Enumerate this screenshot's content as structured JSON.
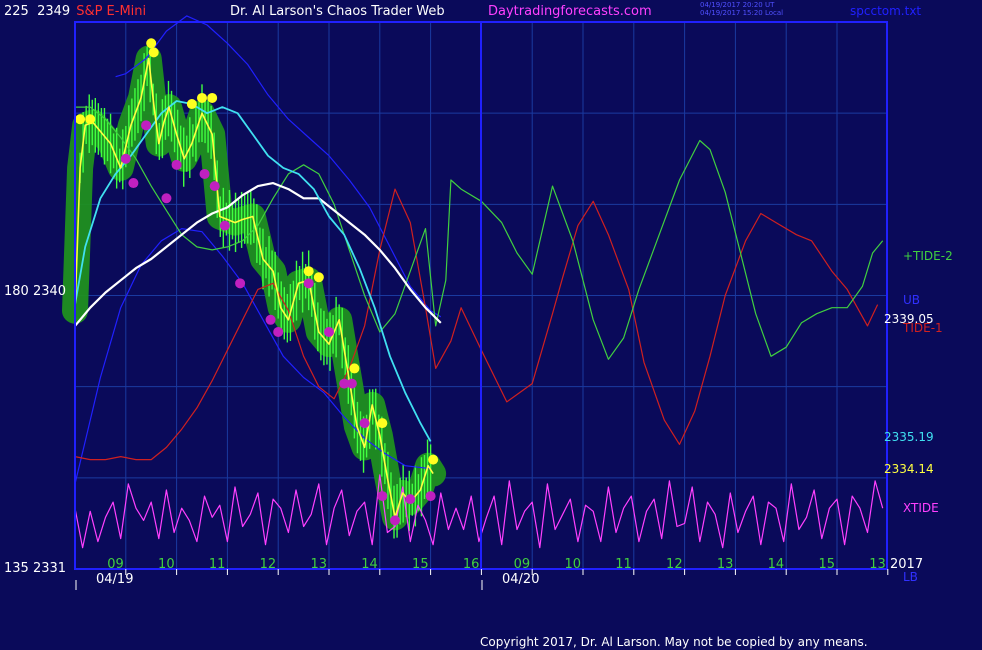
{
  "header": {
    "scale_top": "225",
    "price_top": "2349",
    "symbol": "S&P E-Mini",
    "title": "Dr. Al Larson's Chaos Trader Web",
    "site": "Daytradingforecasts.com",
    "time_utc": "04/19/2017 20:20 UT",
    "time_local": "04/19/2017 15:20 Local",
    "file": "spcctom.txt"
  },
  "footer": {
    "copyright": "Copyright 2017, Dr. Al Larson. May not be copied by any means."
  },
  "colors": {
    "background": "#0a0a5a",
    "frame": "#2020ff",
    "grid": "#1a3aa0",
    "tide1": "#d02020",
    "tide2": "#40d040",
    "xtide": "#ff40ff",
    "band": "#2020ff",
    "ma_white": "#ffffff",
    "ma_cyan": "#40e0f0",
    "price_yellow": "#ffff40",
    "price_bars": "#40ff40",
    "energy_green": "#209020",
    "dot_yellow": "#ffff20",
    "dot_magenta": "#c020c0"
  },
  "chart_data": {
    "type": "line",
    "y_axis_labels": [
      {
        "scale": "225",
        "price": "2349"
      },
      {
        "scale": "180",
        "price": "2340"
      },
      {
        "scale": "135",
        "price": "2331"
      }
    ],
    "ylim": [
      2331,
      2349
    ],
    "x_hour_labels": [
      "09",
      "10",
      "11",
      "12",
      "13",
      "14",
      "15",
      "16",
      "09",
      "10",
      "11",
      "12",
      "13",
      "14",
      "15",
      "13"
    ],
    "x_date_labels": [
      "04/19",
      "04/20"
    ],
    "year_label": "2017",
    "right_labels": [
      {
        "text": "+TIDE-2",
        "color": "#40d040"
      },
      {
        "text": "UB",
        "color": "#3030ff"
      },
      {
        "text": "2339.05",
        "color": "#ffffff"
      },
      {
        "text": "TIDE-1",
        "color": "#d02020"
      },
      {
        "text": "2335.19",
        "color": "#40e0f0"
      },
      {
        "text": "2334.14",
        "color": "#ffff40"
      },
      {
        "text": "XTIDE",
        "color": "#ff40ff"
      },
      {
        "text": "LB",
        "color": "#3030ff"
      }
    ],
    "series": [
      {
        "name": "TIDE-1",
        "x": [
          0,
          0.3,
          0.6,
          0.9,
          1.2,
          1.5,
          1.8,
          2.1,
          2.4,
          2.7,
          3.0,
          3.3,
          3.6,
          3.9,
          4.2,
          4.5,
          4.8,
          5.1,
          5.4,
          5.7,
          6.0,
          6.3,
          6.6,
          6.9,
          7.1,
          7.4,
          7.6,
          8.0,
          8.5,
          9.0,
          9.4,
          9.6,
          9.9,
          10.2,
          10.5,
          10.9,
          11.2,
          11.6,
          11.9,
          12.2,
          12.5,
          12.8,
          13.2,
          13.5,
          13.8,
          14.2,
          14.5,
          14.9,
          15.2,
          15.6,
          15.8
        ],
        "values": [
          2334.7,
          2334.6,
          2334.6,
          2334.7,
          2334.6,
          2334.6,
          2335.0,
          2335.6,
          2336.3,
          2337.2,
          2338.2,
          2339.2,
          2340.2,
          2340.4,
          2339.5,
          2338.0,
          2337.0,
          2336.6,
          2337.6,
          2339.0,
          2341.5,
          2343.5,
          2342.4,
          2339.6,
          2337.6,
          2338.5,
          2339.6,
          2338.2,
          2336.5,
          2337.1,
          2339.4,
          2340.6,
          2342.3,
          2343.1,
          2342.0,
          2340.2,
          2337.8,
          2335.9,
          2335.1,
          2336.2,
          2338.0,
          2340.0,
          2341.8,
          2342.7,
          2342.4,
          2342.0,
          2341.8,
          2340.8,
          2340.2,
          2339.0,
          2339.7
        ]
      },
      {
        "name": "+TIDE-2",
        "x": [
          0,
          0.3,
          0.6,
          0.9,
          1.2,
          1.5,
          1.8,
          2.1,
          2.4,
          2.7,
          3.0,
          3.3,
          3.6,
          3.9,
          4.2,
          4.5,
          4.8,
          5.1,
          5.4,
          5.7,
          6.0,
          6.3,
          6.6,
          6.9,
          7.1,
          7.3,
          7.4,
          7.6,
          8.0,
          8.4,
          8.7,
          9.0,
          9.4,
          9.8,
          10.2,
          10.5,
          10.8,
          11.1,
          11.5,
          11.9,
          12.3,
          12.5,
          12.8,
          13.1,
          13.4,
          13.7,
          14.0,
          14.3,
          14.6,
          14.9,
          15.2,
          15.5,
          15.7,
          15.9
        ],
        "values": [
          2346.2,
          2346.2,
          2345.8,
          2345.2,
          2344.5,
          2343.6,
          2342.8,
          2342.0,
          2341.6,
          2341.5,
          2341.6,
          2341.8,
          2342.3,
          2343.2,
          2344.0,
          2344.3,
          2344.0,
          2343.0,
          2341.5,
          2340.0,
          2338.8,
          2339.4,
          2340.8,
          2342.2,
          2339.0,
          2340.5,
          2343.8,
          2343.5,
          2343.1,
          2342.4,
          2341.4,
          2340.7,
          2343.6,
          2341.8,
          2339.2,
          2337.9,
          2338.6,
          2340.2,
          2342.0,
          2343.8,
          2345.1,
          2344.8,
          2343.4,
          2341.4,
          2339.4,
          2338.0,
          2338.3,
          2339.1,
          2339.4,
          2339.6,
          2339.6,
          2340.3,
          2341.4,
          2341.8
        ]
      },
      {
        "name": "UB",
        "x": [
          0.8,
          1.0,
          1.4,
          1.8,
          2.2,
          2.6,
          3.0,
          3.4,
          3.8,
          4.2,
          4.6,
          5.0,
          5.4,
          5.8,
          6.2,
          6.6,
          7.0,
          7.2
        ],
        "values": [
          2347.2,
          2347.3,
          2347.8,
          2348.7,
          2349.2,
          2348.9,
          2348.3,
          2347.6,
          2346.6,
          2345.8,
          2345.2,
          2344.6,
          2343.8,
          2342.9,
          2341.6,
          2340.3,
          2339.5,
          2339.3
        ]
      },
      {
        "name": "LB",
        "x": [
          0,
          0.2,
          0.5,
          0.9,
          1.3,
          1.7,
          2.1,
          2.5,
          2.9,
          3.3,
          3.7,
          4.1,
          4.5,
          4.9,
          5.3,
          5.7,
          6.1,
          6.5,
          7.0
        ],
        "values": [
          2333.8,
          2335.2,
          2337.3,
          2339.6,
          2341.0,
          2341.8,
          2342.2,
          2342.1,
          2341.3,
          2340.4,
          2339.2,
          2338.0,
          2337.3,
          2336.8,
          2336.0,
          2335.3,
          2334.8,
          2334.4,
          2334.3
        ]
      },
      {
        "name": "MA white",
        "x": [
          0,
          0.3,
          0.6,
          0.9,
          1.2,
          1.5,
          1.8,
          2.1,
          2.4,
          2.7,
          3.0,
          3.3,
          3.6,
          3.9,
          4.2,
          4.5,
          4.8,
          5.1,
          5.4,
          5.7,
          6.0,
          6.3,
          6.6,
          6.9,
          7.2
        ],
        "values": [
          2339.0,
          2339.6,
          2340.1,
          2340.5,
          2340.9,
          2341.2,
          2341.6,
          2342.0,
          2342.4,
          2342.7,
          2342.9,
          2343.3,
          2343.6,
          2343.7,
          2343.5,
          2343.2,
          2343.2,
          2342.8,
          2342.4,
          2342.0,
          2341.5,
          2340.9,
          2340.2,
          2339.6,
          2339.1
        ]
      },
      {
        "name": "MA cyan",
        "x": [
          0,
          0.2,
          0.5,
          0.8,
          1.1,
          1.4,
          1.7,
          2.0,
          2.3,
          2.6,
          2.9,
          3.2,
          3.5,
          3.8,
          4.1,
          4.4,
          4.7,
          5.0,
          5.3,
          5.6,
          5.9,
          6.2,
          6.5,
          6.8,
          7.0
        ],
        "values": [
          2339.7,
          2341.6,
          2343.2,
          2344.0,
          2344.6,
          2345.3,
          2346.0,
          2346.4,
          2346.3,
          2346.0,
          2346.2,
          2346.0,
          2345.3,
          2344.6,
          2344.2,
          2344.0,
          2343.5,
          2342.6,
          2342.0,
          2340.9,
          2339.6,
          2338.0,
          2336.8,
          2335.8,
          2335.2
        ]
      },
      {
        "name": "Price",
        "x": [
          0,
          0.1,
          0.2,
          0.35,
          0.5,
          0.7,
          0.9,
          1.1,
          1.3,
          1.45,
          1.55,
          1.65,
          1.75,
          1.85,
          2.0,
          2.15,
          2.3,
          2.5,
          2.7,
          2.85,
          3.0,
          3.15,
          3.3,
          3.5,
          3.7,
          3.9,
          4.05,
          4.2,
          4.4,
          4.6,
          4.8,
          5.0,
          5.2,
          5.4,
          5.55,
          5.7,
          5.85,
          6.0,
          6.15,
          6.3,
          6.45,
          6.6,
          6.8,
          6.95,
          7.05
        ],
        "values": [
          2339.5,
          2344.2,
          2345.6,
          2345.7,
          2345.4,
          2345.0,
          2344.2,
          2345.6,
          2346.5,
          2347.8,
          2346.3,
          2345.0,
          2345.7,
          2346.2,
          2345.3,
          2344.5,
          2345.0,
          2346.0,
          2345.3,
          2342.6,
          2342.5,
          2342.4,
          2342.5,
          2342.6,
          2341.2,
          2340.8,
          2339.6,
          2339.2,
          2340.4,
          2340.5,
          2338.8,
          2338.4,
          2339.2,
          2337.2,
          2335.7,
          2335.0,
          2336.4,
          2335.4,
          2334.0,
          2332.7,
          2333.5,
          2333.2,
          2333.6,
          2334.4,
          2334.14
        ]
      },
      {
        "name": "XTIDE",
        "x": [
          0,
          0.15,
          0.3,
          0.45,
          0.6,
          0.75,
          0.9,
          1.05,
          1.2,
          1.35,
          1.5,
          1.65,
          1.8,
          1.95,
          2.1,
          2.25,
          2.4,
          2.55,
          2.7,
          2.85,
          3.0,
          3.15,
          3.3,
          3.45,
          3.6,
          3.75,
          3.9,
          4.05,
          4.2,
          4.35,
          4.5,
          4.65,
          4.8,
          4.95,
          5.1,
          5.25,
          5.4,
          5.55,
          5.7,
          5.85,
          6.0,
          6.15,
          6.3,
          6.45,
          6.6,
          6.75,
          6.9,
          7.05,
          7.2,
          7.35,
          7.5,
          7.65,
          7.8,
          7.95,
          8.1,
          8.25,
          8.4,
          8.55,
          8.7,
          8.85,
          9.0,
          9.15,
          9.3,
          9.45,
          9.6,
          9.75,
          9.9,
          10.05,
          10.2,
          10.35,
          10.5,
          10.65,
          10.8,
          10.95,
          11.1,
          11.25,
          11.4,
          11.55,
          11.7,
          11.85,
          12.0,
          12.15,
          12.3,
          12.45,
          12.6,
          12.75,
          12.9,
          13.05,
          13.2,
          13.35,
          13.5,
          13.65,
          13.8,
          13.95,
          14.1,
          14.25,
          14.4,
          14.55,
          14.7,
          14.85,
          15.0,
          15.15,
          15.3,
          15.45,
          15.6,
          15.75,
          15.9
        ],
        "values": [
          2333.0,
          2331.7,
          2332.9,
          2331.9,
          2332.7,
          2333.2,
          2332.0,
          2333.8,
          2333.0,
          2332.6,
          2333.2,
          2332.0,
          2333.6,
          2332.2,
          2333.0,
          2332.6,
          2331.9,
          2333.4,
          2332.7,
          2333.1,
          2331.9,
          2333.7,
          2332.4,
          2332.8,
          2333.5,
          2331.8,
          2333.3,
          2333.0,
          2332.2,
          2333.6,
          2332.4,
          2332.8,
          2333.8,
          2331.8,
          2333.0,
          2333.6,
          2332.1,
          2332.9,
          2333.2,
          2331.8,
          2334.1,
          2332.2,
          2332.4,
          2333.7,
          2331.9,
          2333.1,
          2332.6,
          2331.8,
          2333.5,
          2332.3,
          2333.0,
          2332.3,
          2333.4,
          2331.9,
          2332.7,
          2333.4,
          2331.8,
          2333.9,
          2332.3,
          2332.9,
          2333.2,
          2331.7,
          2333.8,
          2332.3,
          2332.8,
          2333.3,
          2331.9,
          2333.1,
          2332.9,
          2331.9,
          2333.7,
          2332.2,
          2333.0,
          2333.4,
          2331.9,
          2332.9,
          2333.3,
          2332.0,
          2333.9,
          2332.4,
          2332.5,
          2333.7,
          2331.9,
          2333.2,
          2332.8,
          2331.7,
          2333.5,
          2332.2,
          2332.9,
          2333.4,
          2331.8,
          2333.2,
          2333.0,
          2331.9,
          2333.8,
          2332.3,
          2332.7,
          2333.6,
          2332.0,
          2333.0,
          2333.3,
          2331.8,
          2333.4,
          2333.0,
          2332.2,
          2333.9,
          2333.0
        ]
      }
    ],
    "upper_dots": {
      "x": [
        0.1,
        0.3,
        1.5,
        1.55,
        2.3,
        2.5,
        2.7,
        4.6,
        4.8,
        5.5,
        6.05,
        7.05
      ],
      "values": [
        2345.8,
        2345.8,
        2348.3,
        2348.0,
        2346.3,
        2346.5,
        2346.5,
        2340.8,
        2340.6,
        2337.6,
        2335.8,
        2334.6
      ]
    },
    "lower_dots": {
      "x": [
        1.0,
        1.15,
        1.4,
        1.8,
        2.0,
        2.55,
        2.75,
        2.95,
        3.25,
        3.85,
        4.0,
        4.6,
        5.0,
        5.3,
        5.45,
        5.7,
        6.05,
        6.3,
        6.6,
        7.0
      ],
      "values": [
        2344.5,
        2343.7,
        2345.6,
        2343.2,
        2344.3,
        2344.0,
        2343.6,
        2342.3,
        2340.4,
        2339.2,
        2338.8,
        2340.4,
        2338.8,
        2337.1,
        2337.1,
        2335.8,
        2333.4,
        2332.6,
        2333.3,
        2333.4
      ]
    }
  }
}
